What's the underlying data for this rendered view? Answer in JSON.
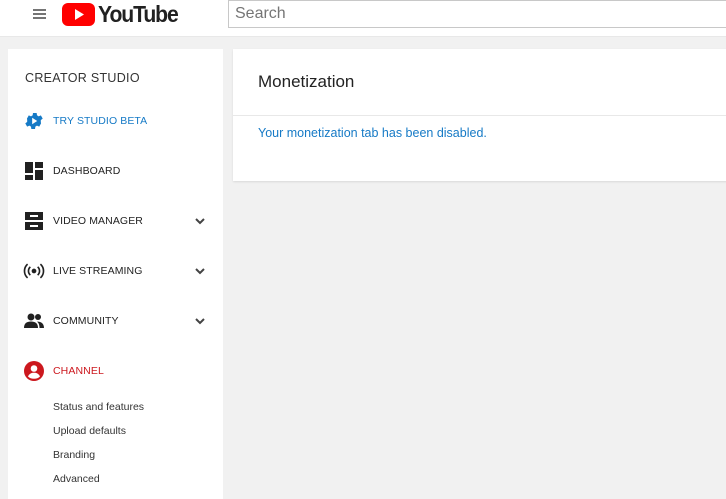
{
  "header": {
    "logo_text": "YouTube",
    "search_placeholder": "Search",
    "brand_color": "#ff0000",
    "icons": [
      "menu-icon",
      "youtube-play-icon"
    ]
  },
  "sidebar": {
    "title": "CREATOR STUDIO",
    "items": [
      {
        "label": "TRY STUDIO BETA",
        "icon": "gear-icon",
        "color": "#167ac6",
        "expandable": false
      },
      {
        "label": "DASHBOARD",
        "icon": "dashboard-icon",
        "color": "#222222",
        "expandable": false
      },
      {
        "label": "VIDEO MANAGER",
        "icon": "video-manager-icon",
        "color": "#222222",
        "expandable": true
      },
      {
        "label": "LIVE STREAMING",
        "icon": "live-streaming-icon",
        "color": "#222222",
        "expandable": true
      },
      {
        "label": "COMMUNITY",
        "icon": "community-icon",
        "color": "#222222",
        "expandable": true
      },
      {
        "label": "CHANNEL",
        "icon": "channel-icon",
        "color": "#cc181e",
        "expandable": false
      }
    ],
    "channel_subitems": [
      "Status and features",
      "Upload defaults",
      "Branding",
      "Advanced"
    ]
  },
  "main": {
    "title": "Monetization",
    "message": "Your monetization tab has been disabled.",
    "message_color": "#167ac6"
  }
}
